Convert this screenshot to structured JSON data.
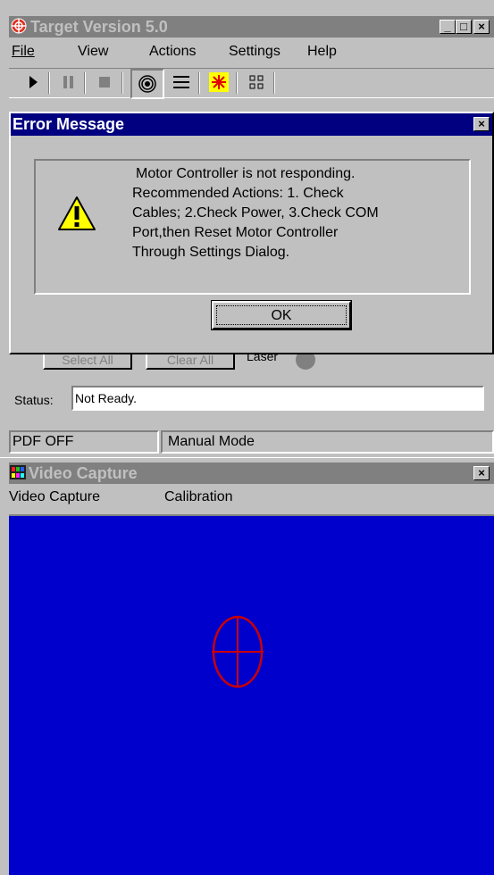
{
  "main_window": {
    "title": "Target Version 5.0",
    "menu": [
      "File",
      "View",
      "Actions",
      "Settings",
      "Help"
    ],
    "select_all": "Select All",
    "clear_all": "Clear All",
    "laser_label": "Laser",
    "status_label": "Status:",
    "status_value": "Not Ready.",
    "statusbar": [
      "PDF OFF",
      "Manual Mode"
    ]
  },
  "dialog": {
    "title": "Error Message",
    "message_lines": [
      "Motor Controller is not responding.",
      "Recommended Actions: 1. Check",
      "Cables; 2.Check Power, 3.Check COM",
      "Port,then Reset Motor Controller",
      "Through Settings Dialog."
    ],
    "ok_label": "OK",
    "icon": "warning-icon"
  },
  "video_window": {
    "title": "Video Capture",
    "menu": [
      "Video Capture",
      "Calibration"
    ],
    "colors": {
      "background": "#0000cc",
      "crosshair": "#cc0000"
    }
  },
  "toolbar_icons": [
    "play-icon",
    "pause-icon",
    "stop-icon",
    "target-icon",
    "list-icon",
    "laser-star-icon",
    "grid-icon"
  ]
}
